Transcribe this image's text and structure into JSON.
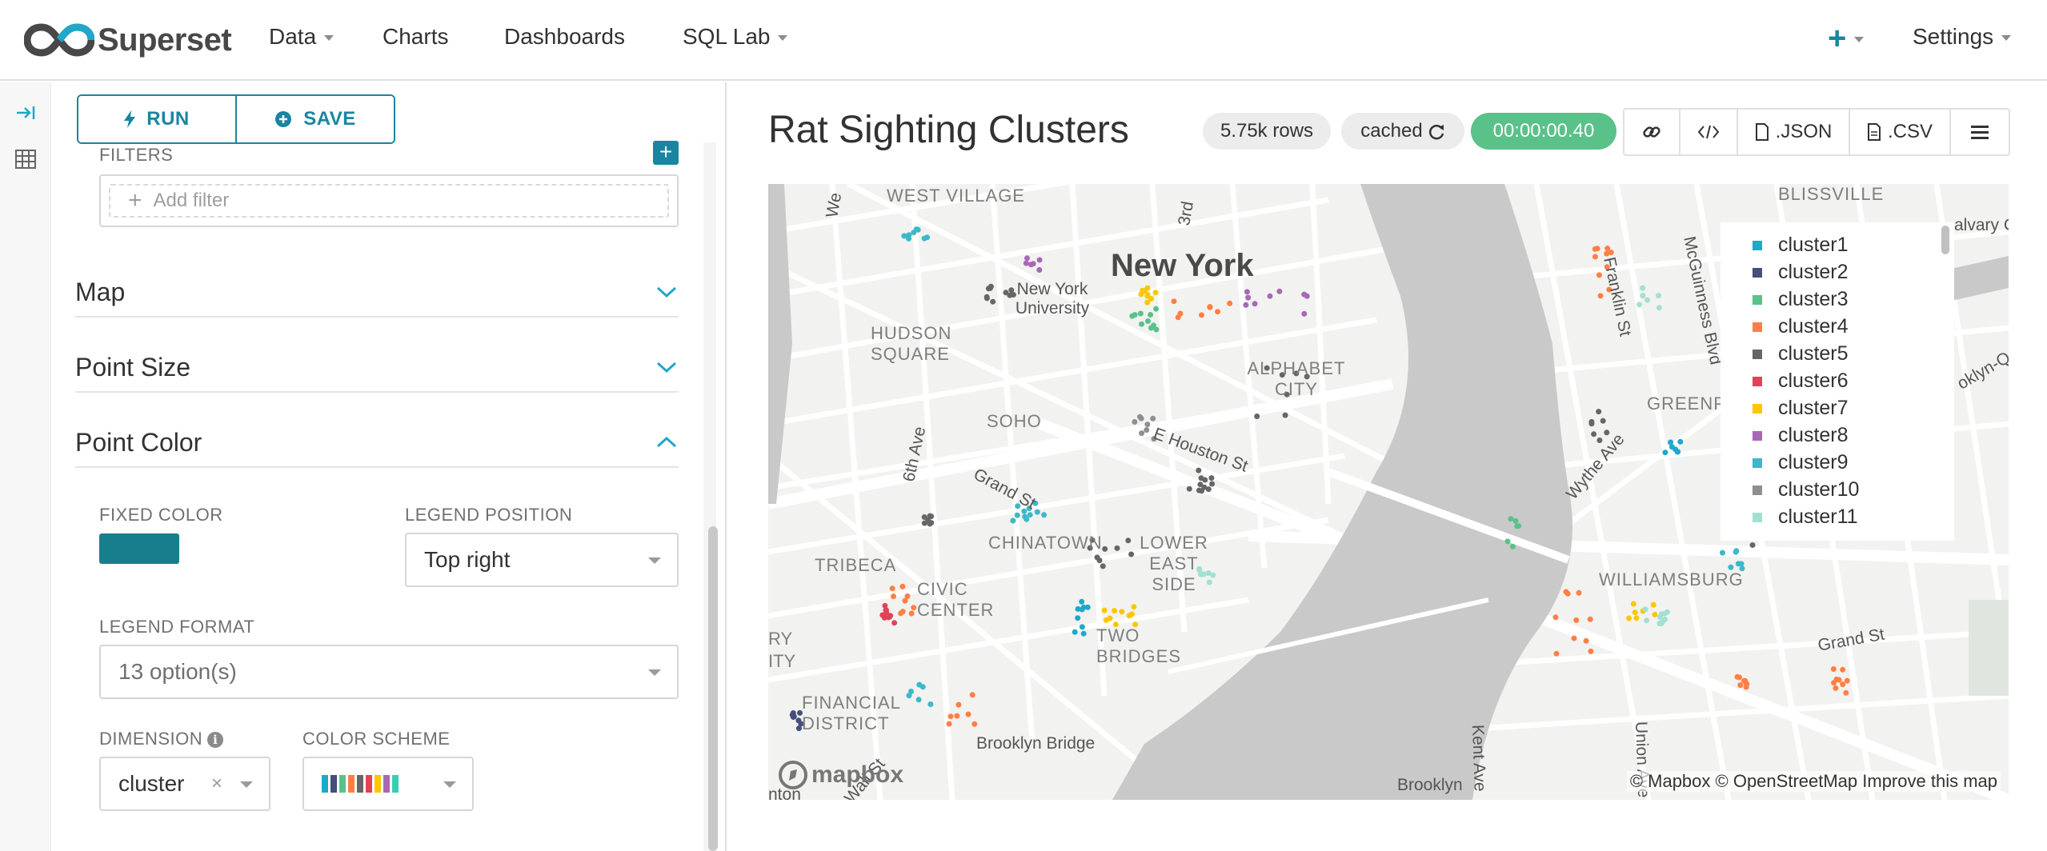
{
  "navbar": {
    "brand": "Superset",
    "items": [
      {
        "label": "Data",
        "dropdown": true
      },
      {
        "label": "Charts",
        "dropdown": false
      },
      {
        "label": "Dashboards",
        "dropdown": false
      },
      {
        "label": "SQL Lab",
        "dropdown": true
      }
    ],
    "settings_label": "Settings",
    "plus_symbol": "+"
  },
  "toolbar": {
    "run_label": "RUN",
    "save_label": "SAVE"
  },
  "controls": {
    "filters_label": "FILTERS",
    "add_filter_placeholder": "Add filter",
    "sections": [
      {
        "title": "Map",
        "expanded": false
      },
      {
        "title": "Point Size",
        "expanded": false
      },
      {
        "title": "Point Color",
        "expanded": true
      }
    ],
    "fixed_color_label": "FIXED COLOR",
    "fixed_color_value": "#167e8c",
    "legend_position_label": "LEGEND POSITION",
    "legend_position_value": "Top right",
    "legend_format_label": "LEGEND FORMAT",
    "legend_format_value": "13 option(s)",
    "dimension_label": "DIMENSION",
    "dimension_value": "cluster",
    "color_scheme_label": "COLOR SCHEME",
    "color_scheme_colors": [
      "#1fa8c9",
      "#454e7c",
      "#5ac189",
      "#ff7f44",
      "#666666",
      "#e04355",
      "#fcc700",
      "#a868b7",
      "#3cccb4"
    ]
  },
  "chart": {
    "title": "Rat Sighting Clusters",
    "rows": "5.75k rows",
    "cached": "cached",
    "timer": "00:00:00.40",
    "json_label": ".JSON",
    "csv_label": ".CSV"
  },
  "map": {
    "city": "New York",
    "neighborhoods": [
      "WEST VILLAGE",
      "HUDSON SQUARE",
      "SOHO",
      "ALPHABET CITY",
      "CHINATOWN",
      "LOWER EAST SIDE",
      "TRIBECA",
      "CIVIC CENTER",
      "TWO BRIDGES",
      "FINANCIAL DISTRICT",
      "WILLIAMSBURG",
      "GREENP",
      "BLISSVILLE"
    ],
    "streets": [
      "New York University",
      "E Houston St",
      "Grand St",
      "6th Ave",
      "Wythe Ave",
      "Franklin St",
      "McGuinness Blvd",
      "Kent Ave",
      "Union Ave",
      "Grand St",
      "Brooklyn Bridge",
      "Brooklyn",
      "Wall St",
      "3rd",
      "We",
      "RY",
      "ITY",
      "nton",
      "alvary C",
      "oklyn-Q"
    ],
    "mapbox_label": "mapbox",
    "attribution": "© Mapbox © OpenStreetMap Improve this map",
    "legend": [
      {
        "label": "cluster1",
        "color": "#1fa8c9"
      },
      {
        "label": "cluster2",
        "color": "#454e7c"
      },
      {
        "label": "cluster3",
        "color": "#5ac189"
      },
      {
        "label": "cluster4",
        "color": "#ff7f44"
      },
      {
        "label": "cluster5",
        "color": "#666666"
      },
      {
        "label": "cluster6",
        "color": "#e04355"
      },
      {
        "label": "cluster7",
        "color": "#fcc700"
      },
      {
        "label": "cluster8",
        "color": "#a868b7"
      },
      {
        "label": "cluster9",
        "color": "#3cb8c9"
      },
      {
        "label": "cluster10",
        "color": "#8f8f8f"
      },
      {
        "label": "cluster11",
        "color": "#a3e0d3"
      }
    ]
  }
}
